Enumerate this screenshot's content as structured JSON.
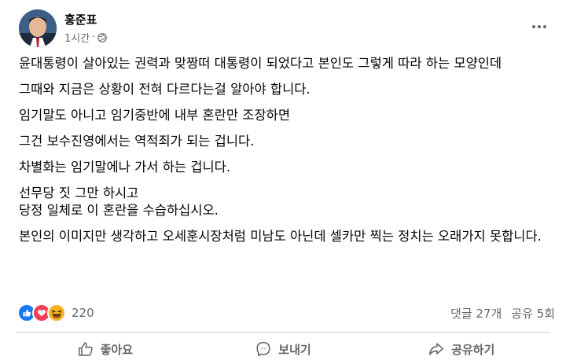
{
  "post": {
    "author": "홍준표",
    "time": "1시간",
    "separator": "·",
    "paragraphs": [
      "윤대통령이 살아있는 권력과 맞짱떠 대통령이 되었다고 본인도 그렇게 따라 하는 모양인데",
      "그때와 지금은 상황이 전혀 다르다는걸 알아야 합니다.",
      "임기말도 아니고 임기중반에 내부 혼란만 조장하면",
      "그건 보수진영에서는 역적죄가 되는 겁니다.",
      "차별화는 임기말에나 가서 하는 겁니다.",
      "선무당 짓 그만 하시고\n당정 일체로 이 혼란을 수습하십시오.",
      "본인의 이미지만 생각하고 오세훈시장처럼 미남도 아닌데 셀카만 찍는 정치는 오래가지 못합니다."
    ],
    "reactions": {
      "icons": [
        "like-icon",
        "love-icon",
        "haha-icon"
      ],
      "count": "220"
    },
    "stats": {
      "comments": "댓글 27개",
      "shares": "공유 5회"
    },
    "actions": {
      "like": "좋아요",
      "send": "보내기",
      "share": "공유하기"
    }
  },
  "colors": {
    "like_blue": "#1877f2",
    "love_red": "#f33e58",
    "haha_yellow": "#f7b125",
    "secondary_text": "#65676b",
    "primary_text": "#050505"
  }
}
